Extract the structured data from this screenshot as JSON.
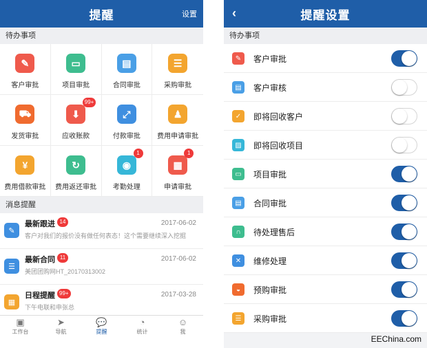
{
  "left": {
    "title": "提醒",
    "settings_link": "设置",
    "todo_section": "待办事项",
    "grid": [
      {
        "label": "客户审批",
        "icon": "user-approve-icon",
        "glyph": "✎",
        "color": "#ef5a4c",
        "badge": ""
      },
      {
        "label": "项目审批",
        "icon": "tray-icon",
        "glyph": "▭",
        "color": "#3ebd8f",
        "badge": ""
      },
      {
        "label": "合同审批",
        "icon": "document-icon",
        "glyph": "▤",
        "color": "#4a9fe6",
        "badge": ""
      },
      {
        "label": "采购审批",
        "icon": "checklist-icon",
        "glyph": "☰",
        "color": "#f3a52f",
        "badge": ""
      },
      {
        "label": "发货审批",
        "icon": "truck-icon",
        "glyph": "⛟",
        "color": "#f06b2f",
        "badge": ""
      },
      {
        "label": "应收账款",
        "icon": "download-icon",
        "glyph": "⬇",
        "color": "#ef5a4c",
        "badge": "99+"
      },
      {
        "label": "付款审批",
        "icon": "expand-icon",
        "glyph": "⤢",
        "color": "#3f8fe0",
        "badge": ""
      },
      {
        "label": "费用申请审批",
        "icon": "stamp-icon",
        "glyph": "♟",
        "color": "#f3a52f",
        "badge": ""
      },
      {
        "label": "费用借款审批",
        "icon": "hand-coin-icon",
        "glyph": "¥",
        "color": "#f3a52f",
        "badge": ""
      },
      {
        "label": "费用返还审批",
        "icon": "refund-icon",
        "glyph": "↻",
        "color": "#3ebd8f",
        "badge": ""
      },
      {
        "label": "考勤处理",
        "icon": "location-pin-icon",
        "glyph": "◉",
        "color": "#36b7d8",
        "badge": "1"
      },
      {
        "label": "申请审批",
        "icon": "form-icon",
        "glyph": "▦",
        "color": "#ef5a4c",
        "badge": "1"
      }
    ],
    "msg_section": "消息提醒",
    "messages": [
      {
        "title": "最新跟进",
        "badge": "14",
        "date": "2017-06-02",
        "sub": "客户对我们的报价没有做任何表态！这个需要继续深入挖掘",
        "icon": "edit-icon",
        "glyph": "✎",
        "color": "#3f8fe0"
      },
      {
        "title": "最新合同",
        "badge": "11",
        "date": "2017-06-02",
        "sub": "美团团购网HT_20170313002",
        "icon": "contract-list-icon",
        "glyph": "☰",
        "color": "#3f8fe0"
      },
      {
        "title": "日程提醒",
        "badge": "99+",
        "date": "2017-03-28",
        "sub": "下午电联和申张总",
        "icon": "calendar-icon",
        "glyph": "▦",
        "color": "#f3a52f"
      }
    ],
    "tabs": [
      {
        "label": "工作台",
        "icon": "workbench-icon",
        "glyph": "▣",
        "active": false
      },
      {
        "label": "导航",
        "icon": "navigation-icon",
        "glyph": "➤",
        "active": false
      },
      {
        "label": "提醒",
        "icon": "chat-bubble-icon",
        "glyph": "💬",
        "active": true
      },
      {
        "label": "统计",
        "icon": "pie-chart-icon",
        "glyph": "◔",
        "active": false
      },
      {
        "label": "我",
        "icon": "smile-icon",
        "glyph": "☺",
        "active": false
      }
    ]
  },
  "right": {
    "title": "提醒设置",
    "back": "‹",
    "section": "待办事项",
    "rows": [
      {
        "label": "客户审批",
        "on": true,
        "icon": "user-approve-icon",
        "glyph": "✎",
        "color": "#ef5a4c"
      },
      {
        "label": "客户审核",
        "on": false,
        "icon": "id-card-icon",
        "glyph": "▤",
        "color": "#4a9fe6"
      },
      {
        "label": "即将回收客户",
        "on": false,
        "icon": "recycle-user-icon",
        "glyph": "✓",
        "color": "#f3a52f"
      },
      {
        "label": "即将回收项目",
        "on": false,
        "icon": "image-icon",
        "glyph": "▨",
        "color": "#36b7d8"
      },
      {
        "label": "项目审批",
        "on": true,
        "icon": "tray-icon",
        "glyph": "▭",
        "color": "#3ebd8f"
      },
      {
        "label": "合同审批",
        "on": true,
        "icon": "document-icon",
        "glyph": "▤",
        "color": "#4a9fe6"
      },
      {
        "label": "待处理售后",
        "on": true,
        "icon": "headset-icon",
        "glyph": "∩",
        "color": "#3ebd8f"
      },
      {
        "label": "维修处理",
        "on": true,
        "icon": "tools-icon",
        "glyph": "✕",
        "color": "#3f8fe0"
      },
      {
        "label": "预购审批",
        "on": true,
        "icon": "basket-icon",
        "glyph": "◒",
        "color": "#f06b2f"
      },
      {
        "label": "采购审批",
        "on": true,
        "icon": "checklist-icon",
        "glyph": "☰",
        "color": "#f3a52f"
      }
    ]
  },
  "watermark": "EEChina.com"
}
